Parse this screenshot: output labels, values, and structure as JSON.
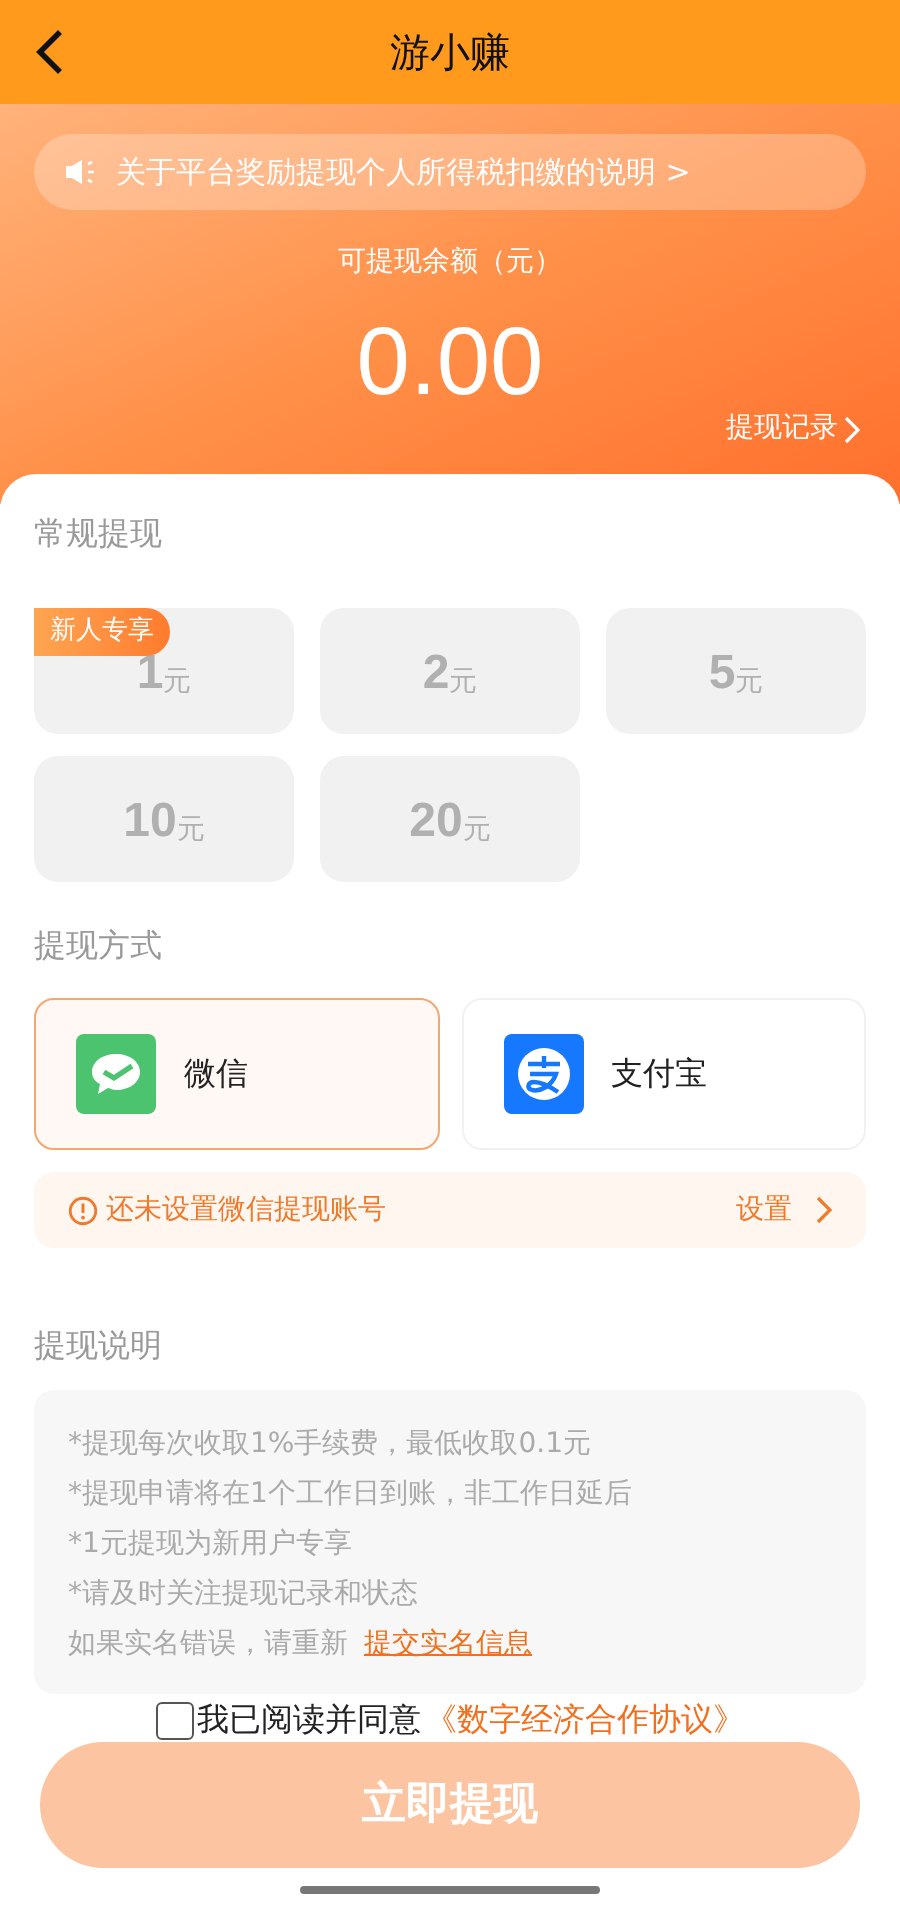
{
  "header": {
    "title": "游小赚"
  },
  "notice": {
    "text": "关于平台奖励提现个人所得税扣缴的说明 >"
  },
  "balance": {
    "label": "可提现余额（元）",
    "amount": "0.00",
    "records_link": "提现记录"
  },
  "regular": {
    "title": "常规提现",
    "options": [
      {
        "amount": "1",
        "unit": "元",
        "badge": "新人专享",
        "selected": false
      },
      {
        "amount": "2",
        "unit": "元",
        "selected": false
      },
      {
        "amount": "5",
        "unit": "元",
        "selected": false
      },
      {
        "amount": "10",
        "unit": "元",
        "selected": false
      },
      {
        "amount": "20",
        "unit": "元",
        "selected": false
      }
    ]
  },
  "methods": {
    "title": "提现方式",
    "items": [
      {
        "kind": "wechat",
        "label": "微信",
        "selected": true
      },
      {
        "kind": "alipay",
        "label": "支付宝",
        "selected": false
      }
    ]
  },
  "account_warning": {
    "text": "还未设置微信提现账号",
    "action": "设置"
  },
  "instructions": {
    "title": "提现说明",
    "lines": [
      "*提现每次收取1%手续费，最低收取0.1元",
      "*提现申请将在1个工作日到账，非工作日延后",
      "*1元提现为新用户专享",
      "*请及时关注提现记录和状态"
    ],
    "footer": "如果实名错误，请重新",
    "footer_link": "提交实名信息"
  },
  "agreement": {
    "checked": false,
    "text": "我已阅读并同意",
    "link": "《数字经济合作协议》"
  },
  "submit": {
    "label": "立即提现",
    "disabled": true
  }
}
